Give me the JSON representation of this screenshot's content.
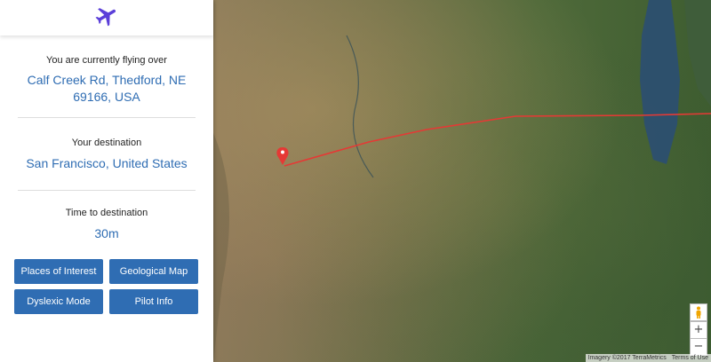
{
  "sidebar": {
    "logo_icon": "airplane-icon",
    "current_label": "You are currently flying over",
    "current_value": "Calf Creek Rd, Thedford, NE 69166, USA",
    "destination_label": "Your destination",
    "destination_value": "San Francisco, United States",
    "time_label": "Time to destination",
    "time_value": "30m",
    "buttons": [
      "Places of Interest",
      "Geological Map",
      "Dyslexic Mode",
      "Pilot Info"
    ]
  },
  "map": {
    "zoom_in": "+",
    "zoom_out": "−",
    "imagery_credit": "Imagery ©2017 TerraMetrics",
    "terms": "Terms of Use",
    "route_color": "#e53935",
    "pegman_icon": "pegman-icon",
    "marker_icon": "map-pin-icon"
  },
  "colors": {
    "accent": "#2f6db3",
    "logo": "#5b3fd9"
  }
}
